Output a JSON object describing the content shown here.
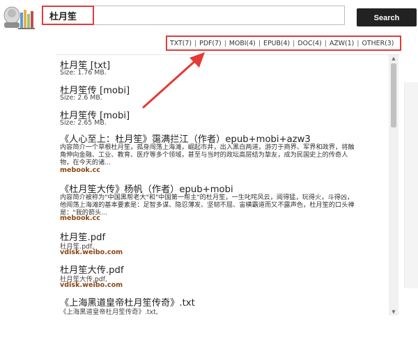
{
  "search": {
    "value": "杜月笙",
    "button": "Search"
  },
  "formats": [
    "TXT(7)",
    "PDF(7)",
    "MOBI(4)",
    "EPUB(4)",
    "DOC(4)",
    "AZW(1)",
    "OTHER(3)"
  ],
  "results": [
    {
      "title": "杜月笙 [txt]",
      "sub": "Size: 1.76 MB."
    },
    {
      "title": "杜月笙传 [mobi]",
      "sub": "Size: 2.6 MB."
    },
    {
      "title": "杜月笙传 [mobi]",
      "sub": "Size: 2.65 MB."
    },
    {
      "title": "《人心至上：杜月笙》霭满拦江（作者）epub+mobi+azw3",
      "desc": "内容简介一个草根杜月笙，孤身闯荡上海滩，崛起市井，出入黑白两道，游刃于商界、军界和政界，将触角伸向金融、工业、教育、医疗等多个领域，甚至与当时的政坛高层结为挚友，成为民国史上的传奇人物，在今天的诸...",
      "link": "mebook.cc"
    },
    {
      "title": "《杜月笙大传》杨帆（作者）epub+mobi",
      "desc": "内容简介被称为\"中国黑帮老大\"和\"中国第一帮主\"的杜月笙，一生叱咤风云，阅得猛，玩得火，斗得凶，他闯荡上海滩的基本要素是：足智多谋、隐忍薄发、坚韧不屈、宙横霸道而又不露声色，杜月笙的口头禅是：\"我的箭头...",
      "link": "mebook.cc"
    },
    {
      "title": "杜月笙.pdf",
      "sub": "杜月笙.pdf,",
      "link": "vdisk.weibo.com"
    },
    {
      "title": "杜月笙大传.pdf",
      "sub": "杜月笙大传.pdf,",
      "link": "vdisk.weibo.com"
    },
    {
      "title": "《上海黑道皇帝杜月笙传奇》.txt",
      "sub": "《上海黑道皇帝杜月笙传奇》.txt,"
    }
  ]
}
